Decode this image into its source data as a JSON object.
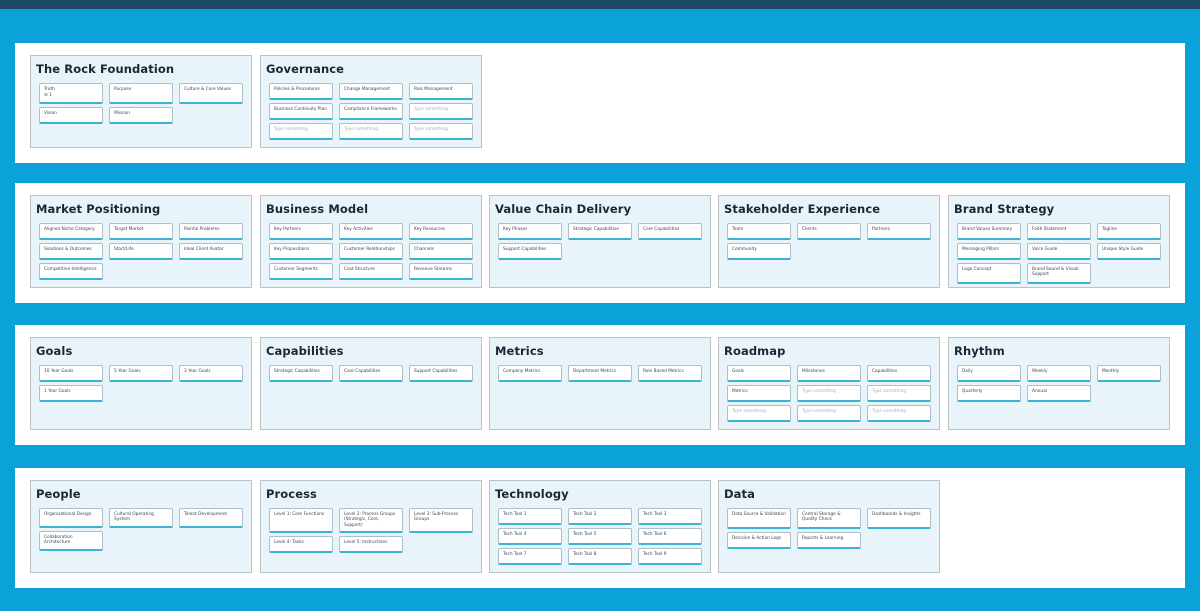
{
  "rows": [
    {
      "panels": [
        {
          "title": "The Rock Foundation",
          "cards": [
            {
              "label": "Truth",
              "value": "☰ 1"
            },
            {
              "label": "Purpose"
            },
            {
              "label": "Culture & Core Values"
            },
            {
              "label": "Vision"
            },
            {
              "label": "Mission"
            }
          ]
        },
        {
          "title": "Governance",
          "cards": [
            {
              "label": "Policies & Procedures"
            },
            {
              "label": "Change Management"
            },
            {
              "label": "Risk Management"
            },
            {
              "label": "Business Continuity Plan"
            },
            {
              "label": "Compliance Frameworks"
            },
            {
              "label": "Type something",
              "placeholder": true
            },
            {
              "label": "Type something",
              "placeholder": true
            },
            {
              "label": "Type something",
              "placeholder": true
            },
            {
              "label": "Type something",
              "placeholder": true
            }
          ]
        }
      ]
    },
    {
      "panels": [
        {
          "title": "Market Positioning",
          "cards": [
            {
              "label": "Aligned Niche Category"
            },
            {
              "label": "Target Market"
            },
            {
              "label": "Painful Problems"
            },
            {
              "label": "Solutions & Outcomes"
            },
            {
              "label": "Start/Life"
            },
            {
              "label": "Ideal Client Avatar"
            },
            {
              "label": "Competitive Intelligence"
            }
          ]
        },
        {
          "title": "Business Model",
          "cards": [
            {
              "label": "Key Partners"
            },
            {
              "label": "Key Activities"
            },
            {
              "label": "Key Resources"
            },
            {
              "label": "Key Propositions"
            },
            {
              "label": "Customer Relationships"
            },
            {
              "label": "Channels"
            },
            {
              "label": "Customer Segments"
            },
            {
              "label": "Cost Structure"
            },
            {
              "label": "Revenue Streams"
            }
          ]
        },
        {
          "title": "Value Chain Delivery",
          "cards": [
            {
              "label": "Key Phases"
            },
            {
              "label": "Strategic Capabilities"
            },
            {
              "label": "Core Capabilities"
            },
            {
              "label": "Support Capabilities"
            }
          ]
        },
        {
          "title": "Stakeholder Experience",
          "cards": [
            {
              "label": "Team"
            },
            {
              "label": "Clients"
            },
            {
              "label": "Partners"
            },
            {
              "label": "Community"
            }
          ]
        },
        {
          "title": "Brand Strategy",
          "cards": [
            {
              "label": "Brand Values Summary"
            },
            {
              "label": "Faith Statement"
            },
            {
              "label": "Tagline"
            },
            {
              "label": "Messaging Pillars"
            },
            {
              "label": "Voice Guide"
            },
            {
              "label": "Unique Style Guide"
            },
            {
              "label": "Logo Concept"
            },
            {
              "label": "Brand Sound & Visual Support",
              "tall": true
            }
          ]
        }
      ]
    },
    {
      "panels": [
        {
          "title": "Goals",
          "cards": [
            {
              "label": "10 Year Goals"
            },
            {
              "label": "5 Year Goals"
            },
            {
              "label": "3 Year Goals"
            },
            {
              "label": "1 Year Goals"
            }
          ]
        },
        {
          "title": "Capabilities",
          "cards": [
            {
              "label": "Strategic Capabilities"
            },
            {
              "label": "Core Capabilities"
            },
            {
              "label": "Support Capabilities"
            }
          ]
        },
        {
          "title": "Metrics",
          "cards": [
            {
              "label": "Company Metrics"
            },
            {
              "label": "Department Metrics"
            },
            {
              "label": "Role Based Metrics"
            }
          ]
        },
        {
          "title": "Roadmap",
          "cards": [
            {
              "label": "Goals"
            },
            {
              "label": "Milestones"
            },
            {
              "label": "Capabilities"
            },
            {
              "label": "Metrics"
            },
            {
              "label": "Type something",
              "placeholder": true
            },
            {
              "label": "Type something",
              "placeholder": true
            },
            {
              "label": "Type something",
              "placeholder": true
            },
            {
              "label": "Type something",
              "placeholder": true
            },
            {
              "label": "Type something",
              "placeholder": true
            }
          ]
        },
        {
          "title": "Rhythm",
          "cards": [
            {
              "label": "Daily"
            },
            {
              "label": "Weekly"
            },
            {
              "label": "Monthly"
            },
            {
              "label": "Quarterly"
            },
            {
              "label": "Annual"
            }
          ]
        }
      ]
    },
    {
      "panels": [
        {
          "title": "People",
          "cards": [
            {
              "label": "Organizational Design"
            },
            {
              "label": "Cultural Operating System"
            },
            {
              "label": "Talent Development"
            },
            {
              "label": "Collaboration Architecture"
            }
          ]
        },
        {
          "title": "Process",
          "cards": [
            {
              "label": "Level 1: Core Functions"
            },
            {
              "label": "Level 2: Process Groups (Strategic, Core, Support)",
              "tall": true
            },
            {
              "label": "Level 3: Sub-Process Groups"
            },
            {
              "label": "Level 4: Tasks"
            },
            {
              "label": "Level 5: Instructions"
            }
          ]
        },
        {
          "title": "Technology",
          "cards": [
            {
              "label": "Tech Tool 1"
            },
            {
              "label": "Tech Tool 2"
            },
            {
              "label": "Tech Tool 3"
            },
            {
              "label": "Tech Tool 4"
            },
            {
              "label": "Tech Tool 5"
            },
            {
              "label": "Tech Tool 6"
            },
            {
              "label": "Tech Tool 7"
            },
            {
              "label": "Tech Tool 8"
            },
            {
              "label": "Tech Tool 9"
            }
          ]
        },
        {
          "title": "Data",
          "cards": [
            {
              "label": "Data Source & Validation"
            },
            {
              "label": "Central Storage & Quality Check",
              "tall": true
            },
            {
              "label": "Dashboards & Insights"
            },
            {
              "label": "Decision & Action Logs"
            },
            {
              "label": "Reports & Learning"
            }
          ]
        }
      ]
    }
  ]
}
